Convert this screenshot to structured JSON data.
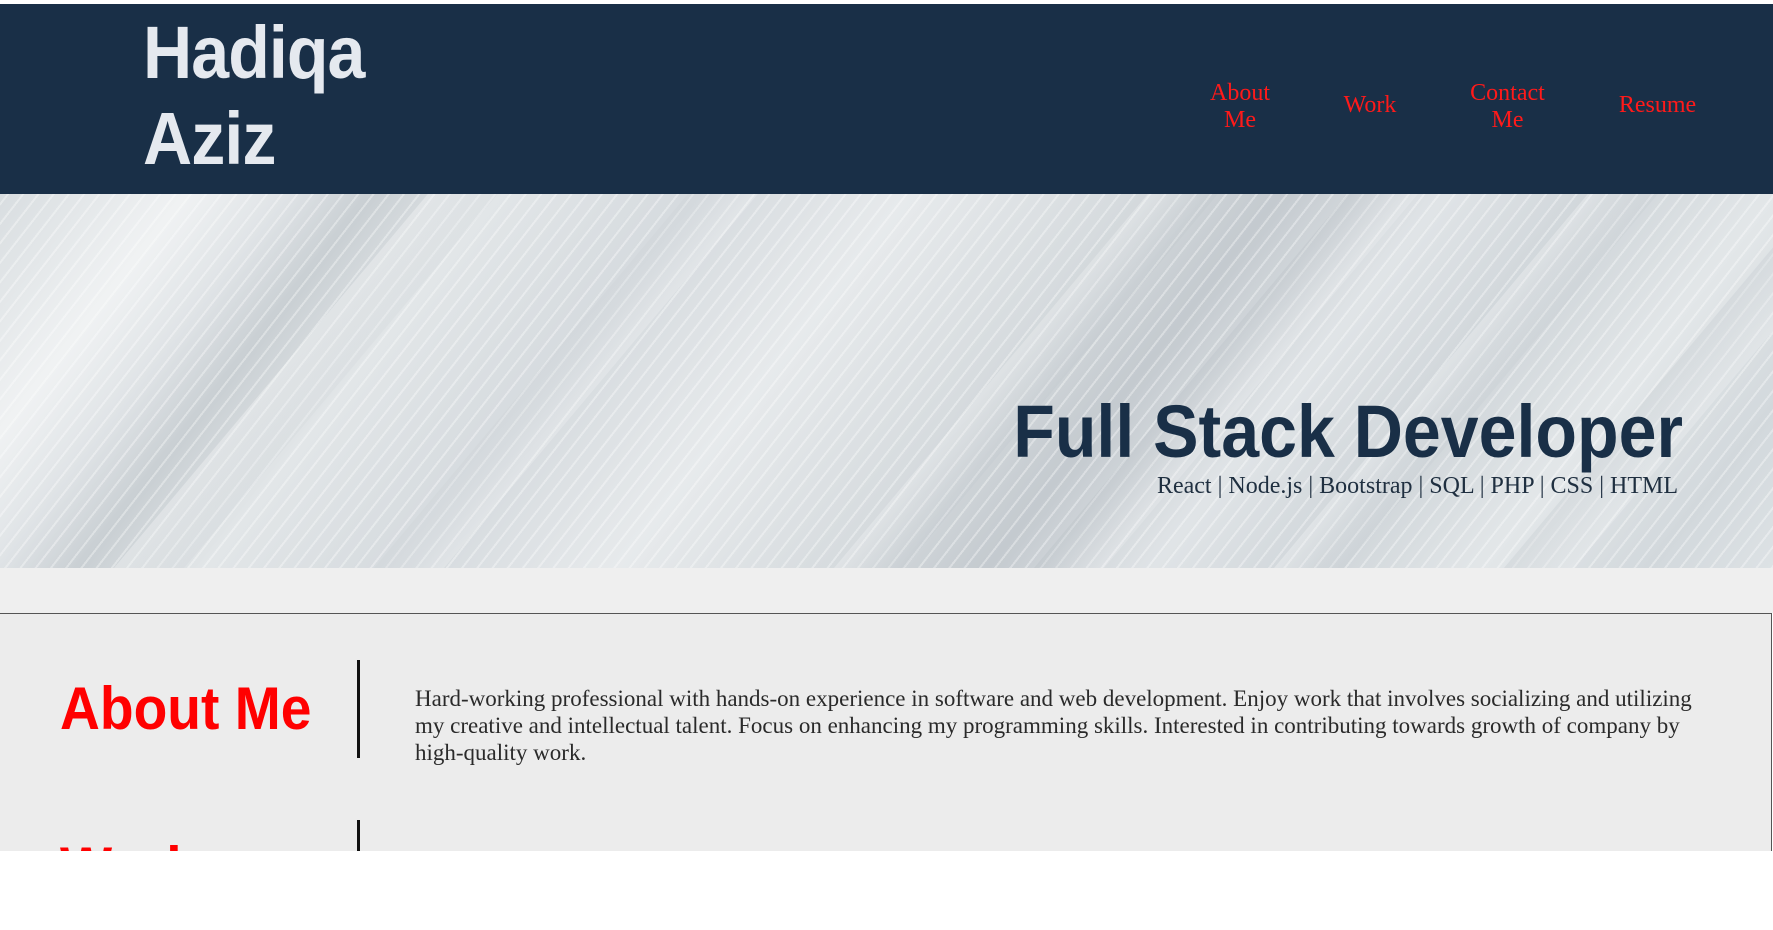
{
  "header": {
    "brand_line1": "Hadiqa",
    "brand_line2": "Aziz",
    "nav": {
      "about": "About Me",
      "work": "Work",
      "contact": "Contact Me",
      "resume": "Resume"
    }
  },
  "hero": {
    "title": "Full Stack Developer",
    "skills": "React | Node.js | Bootstrap | SQL | PHP | CSS | HTML"
  },
  "about": {
    "heading": "About Me",
    "text": "Hard-working professional with hands-on experience in software and web development. Enjoy work that involves socializing and utilizing my creative and intellectual talent. Focus on enhancing my programming skills. Interested in contributing towards growth of company by high-quality work."
  },
  "work": {
    "heading": "Work"
  },
  "colors": {
    "header_bg": "#192f47",
    "accent_red": "#ff0000",
    "hero_title": "#192f47",
    "content_bg": "#ececec"
  }
}
